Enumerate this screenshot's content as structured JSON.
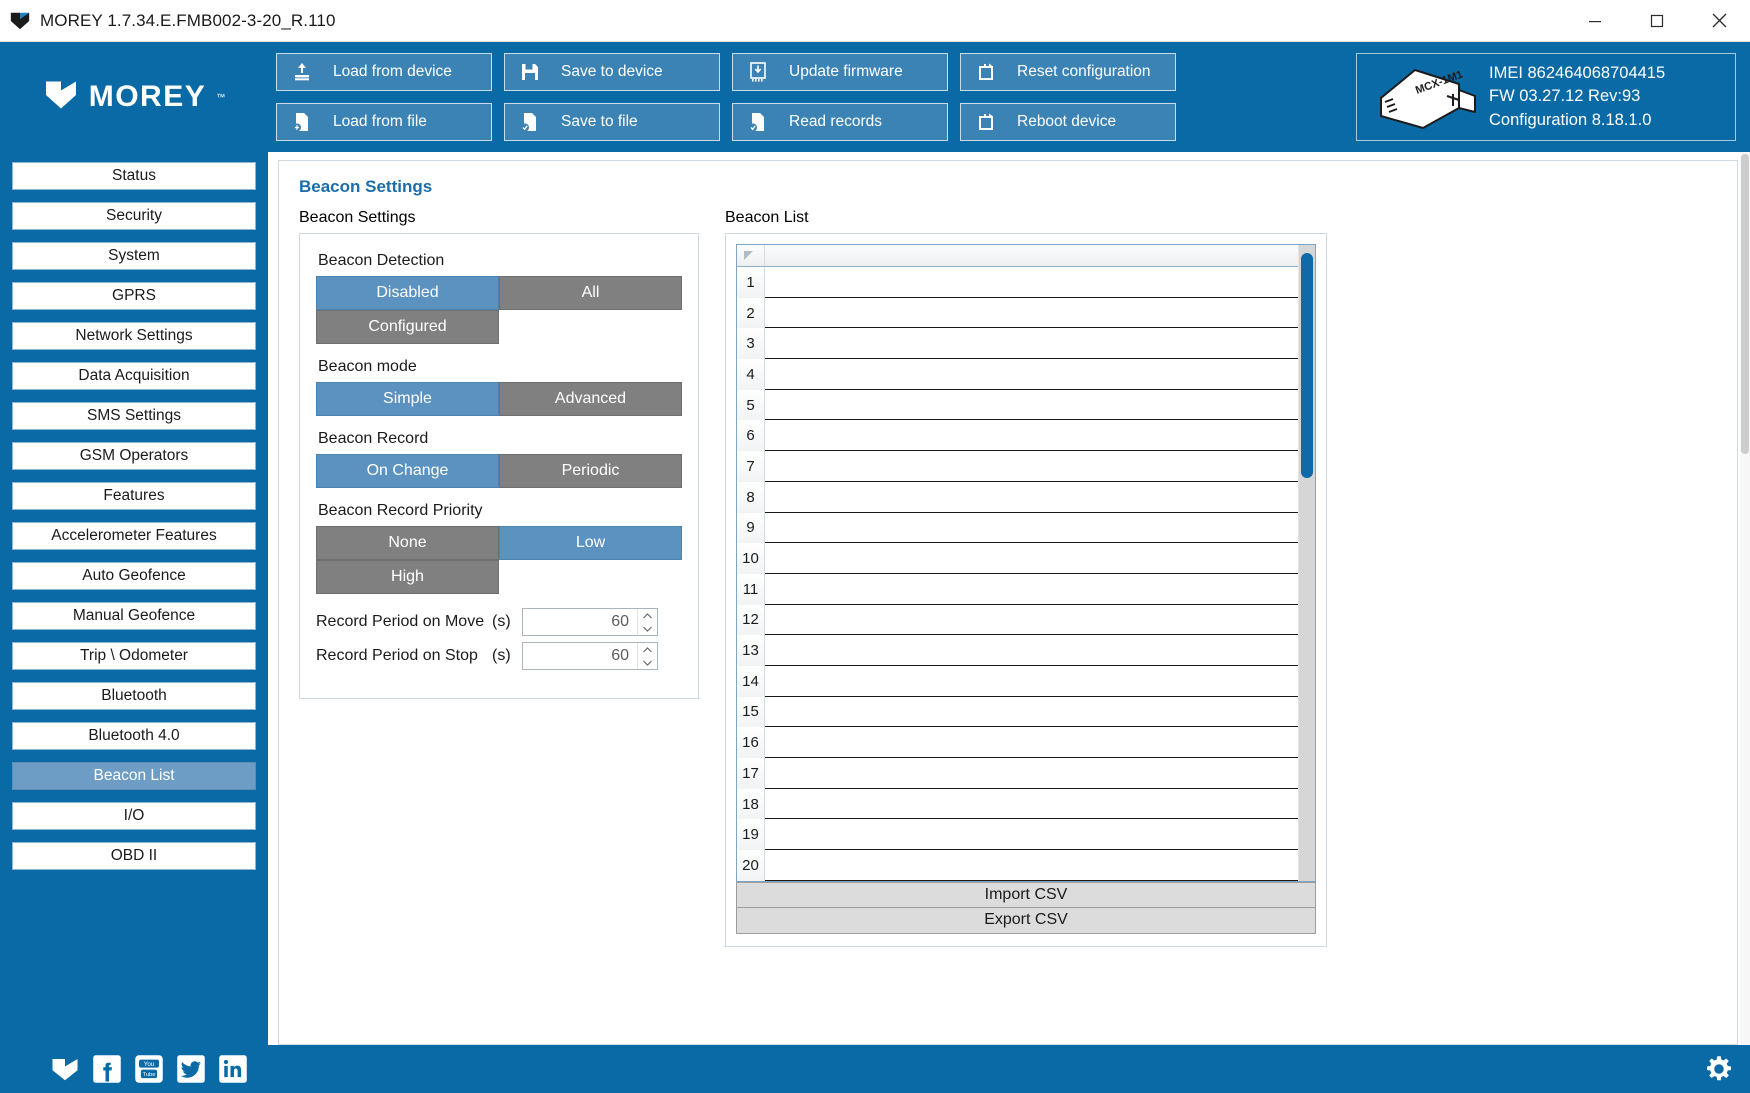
{
  "window": {
    "title": "MOREY 1.7.34.E.FMB002-3-20_R.110",
    "app_icon": "morey-chevron-icon",
    "minimize_label": "Minimize",
    "maximize_label": "Maximize",
    "close_label": "Close"
  },
  "brand": {
    "name": "MOREY",
    "tm": "™",
    "logo_icon": "morey-chevron-logo"
  },
  "toolbar": {
    "buttons": [
      {
        "label": "Load from device",
        "icon": "upload-to-device-icon"
      },
      {
        "label": "Save to device",
        "icon": "floppy-disk-icon"
      },
      {
        "label": "Update firmware",
        "icon": "firmware-download-icon"
      },
      {
        "label": "Reset configuration",
        "icon": "reset-icon"
      },
      {
        "label": "Load from file",
        "icon": "file-load-icon"
      },
      {
        "label": "Save to file",
        "icon": "file-save-icon"
      },
      {
        "label": "Read records",
        "icon": "file-records-icon"
      },
      {
        "label": "Reboot device",
        "icon": "reboot-icon"
      }
    ]
  },
  "device_info": {
    "image_label": "MCX-1M1",
    "imei": "IMEI 862464068704415",
    "firmware": "FW 03.27.12 Rev:93",
    "configuration": "Configuration 8.18.1.0"
  },
  "sidebar": {
    "items": [
      {
        "label": "Status",
        "active": false
      },
      {
        "label": "Security",
        "active": false
      },
      {
        "label": "System",
        "active": false
      },
      {
        "label": "GPRS",
        "active": false
      },
      {
        "label": "Network Settings",
        "active": false
      },
      {
        "label": "Data Acquisition",
        "active": false
      },
      {
        "label": "SMS Settings",
        "active": false
      },
      {
        "label": "GSM Operators",
        "active": false
      },
      {
        "label": "Features",
        "active": false
      },
      {
        "label": "Accelerometer Features",
        "active": false
      },
      {
        "label": "Auto Geofence",
        "active": false
      },
      {
        "label": "Manual Geofence",
        "active": false
      },
      {
        "label": "Trip \\ Odometer",
        "active": false
      },
      {
        "label": "Bluetooth",
        "active": false
      },
      {
        "label": "Bluetooth 4.0",
        "active": false
      },
      {
        "label": "Beacon List",
        "active": true
      },
      {
        "label": "I/O",
        "active": false
      },
      {
        "label": "OBD II",
        "active": false
      }
    ]
  },
  "page": {
    "title": "Beacon Settings",
    "settings_group": {
      "title": "Beacon Settings",
      "fields": [
        {
          "label": "Beacon Detection",
          "options": [
            "Disabled",
            "All",
            "Configured"
          ],
          "selected": "Disabled"
        },
        {
          "label": "Beacon mode",
          "options": [
            "Simple",
            "Advanced"
          ],
          "selected": "Simple"
        },
        {
          "label": "Beacon Record",
          "options": [
            "On Change",
            "Periodic"
          ],
          "selected": "On Change"
        },
        {
          "label": "Beacon Record Priority",
          "options": [
            "None",
            "Low",
            "High"
          ],
          "selected": "Low"
        }
      ],
      "spinners": [
        {
          "label": "Record Period on Move",
          "unit": "(s)",
          "value": "60"
        },
        {
          "label": "Record Period on Stop",
          "unit": "(s)",
          "value": "60"
        }
      ]
    },
    "beacon_list_group": {
      "title": "Beacon List",
      "column_header": "",
      "rows": [
        {
          "num": "1",
          "value": ""
        },
        {
          "num": "2",
          "value": ""
        },
        {
          "num": "3",
          "value": ""
        },
        {
          "num": "4",
          "value": ""
        },
        {
          "num": "5",
          "value": ""
        },
        {
          "num": "6",
          "value": ""
        },
        {
          "num": "7",
          "value": ""
        },
        {
          "num": "8",
          "value": ""
        },
        {
          "num": "9",
          "value": ""
        },
        {
          "num": "10",
          "value": ""
        },
        {
          "num": "11",
          "value": ""
        },
        {
          "num": "12",
          "value": ""
        },
        {
          "num": "13",
          "value": ""
        },
        {
          "num": "14",
          "value": ""
        },
        {
          "num": "15",
          "value": ""
        },
        {
          "num": "16",
          "value": ""
        },
        {
          "num": "17",
          "value": ""
        },
        {
          "num": "18",
          "value": ""
        },
        {
          "num": "19",
          "value": ""
        },
        {
          "num": "20",
          "value": ""
        }
      ],
      "import_label": "Import CSV",
      "export_label": "Export CSV"
    }
  },
  "footer": {
    "social": [
      {
        "name": "morey-icon"
      },
      {
        "name": "facebook-icon"
      },
      {
        "name": "youtube-icon"
      },
      {
        "name": "twitter-icon"
      },
      {
        "name": "linkedin-icon"
      }
    ],
    "settings_icon": "gear-icon"
  },
  "colors": {
    "brand_blue": "#0a6aa6",
    "button_blue": "#3b83b5",
    "segment_gray": "#808080",
    "segment_selected": "#5b92c0",
    "group_label": "#1b6ea8",
    "sidebar_active": "#6d9dc4"
  }
}
